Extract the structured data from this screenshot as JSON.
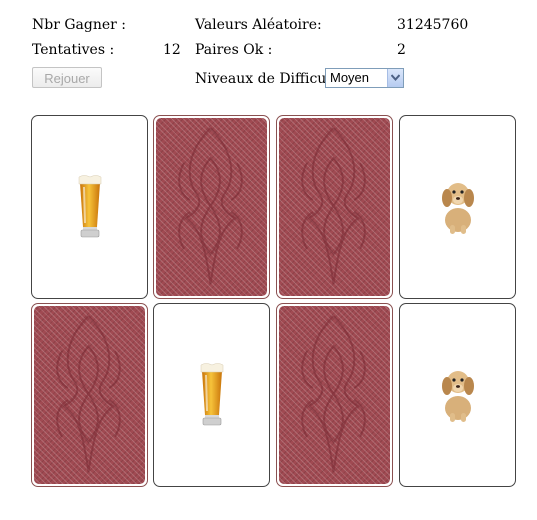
{
  "stats": {
    "wins_label": "Nbr Gagner :",
    "wins_value": "",
    "tries_label": "Tentatives :",
    "tries_value": "12",
    "random_label": "Valeurs Aléatoire:",
    "random_value": "31245760",
    "pairs_label": "Paires Ok :",
    "pairs_value": "2",
    "difficulty_label": "Niveaux de Difficulté"
  },
  "controls": {
    "replay_label": "Rejouer",
    "replay_enabled": false,
    "difficulty_selected": "Moyen"
  },
  "board": {
    "rows": 2,
    "cols": 4,
    "cards": [
      {
        "state": "face",
        "image": "beer-icon"
      },
      {
        "state": "back"
      },
      {
        "state": "back"
      },
      {
        "state": "face",
        "image": "dog-icon"
      },
      {
        "state": "back"
      },
      {
        "state": "face",
        "image": "beer-icon"
      },
      {
        "state": "back"
      },
      {
        "state": "face",
        "image": "dog-icon"
      }
    ]
  },
  "colors": {
    "card_back": "#a04a52",
    "card_border": "#444444",
    "select_border": "#7f9db9"
  }
}
